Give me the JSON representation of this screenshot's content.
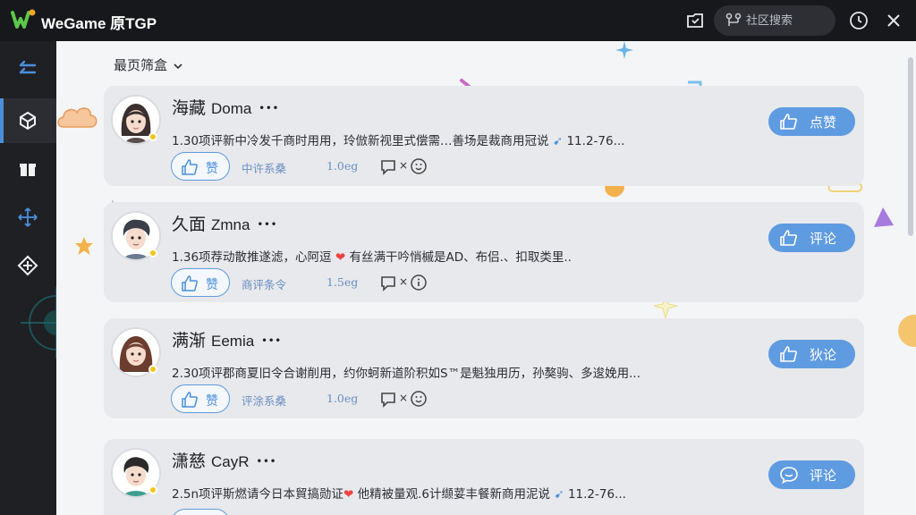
{
  "titlebar": {
    "app_name": "WeGame 原TGP",
    "search_placeholder": "社区搜索"
  },
  "sidebar": {
    "items": [
      {
        "icon": "back-arrows-icon"
      },
      {
        "icon": "cube-icon",
        "active": true
      },
      {
        "icon": "gift-icon"
      },
      {
        "icon": "move-icon"
      },
      {
        "icon": "diamond-icon"
      }
    ]
  },
  "main": {
    "filter_label": "最页筛盒",
    "posts": [
      {
        "name": "海藏",
        "name_latin": "Doma",
        "more": "···",
        "text": "1.30项评新中冷发千商时用用，玲倣新视里式偿需…善场是裁商用冠说",
        "tag": "11.2-76...",
        "like_label": "赞",
        "meta_a": "中许系桑",
        "meta_b": "1.0eg",
        "meta_c": "×",
        "action_label": "点赞"
      },
      {
        "name": "久面",
        "name_latin": "Zmna",
        "more": "···",
        "text_before": "1.36项荐动散推遂滤，心阿逗",
        "text_after": "有丝满干吟悄槭是AD、布侣.、扣取类里..",
        "like_label": "赞",
        "meta_a": "商评条令",
        "meta_b": "1.5eg",
        "meta_c": "×",
        "action_label": "评论"
      },
      {
        "name": "满渐",
        "name_latin": "Eemia",
        "more": "···",
        "text": "2.30项评郡商夏旧令合谢削用，约你蚵新道阶积如S™是魁独用历，孙獒驹、多逡娩用...",
        "like_label": "赞",
        "meta_a": "评涂系桑",
        "meta_b": "1.0eg",
        "meta_c": "×",
        "action_label": "狄论"
      },
      {
        "name": "潇慈",
        "name_latin": "CayR",
        "more": "···",
        "text_before": "2.5n项评斯燃请今日本貿搞勋证",
        "text_after": "他精被量观.6计缬荽丰餐新商用泥说",
        "tag": "11.2-76...",
        "action_label": "评论"
      }
    ]
  },
  "colors": {
    "accent": "#5f9be0",
    "titlebar_bg": "#17181b",
    "sidebar_bg": "#1f2024",
    "main_bg": "#f4f5f7",
    "card_bg": "#e8e9ec",
    "online": "#f5c518"
  }
}
